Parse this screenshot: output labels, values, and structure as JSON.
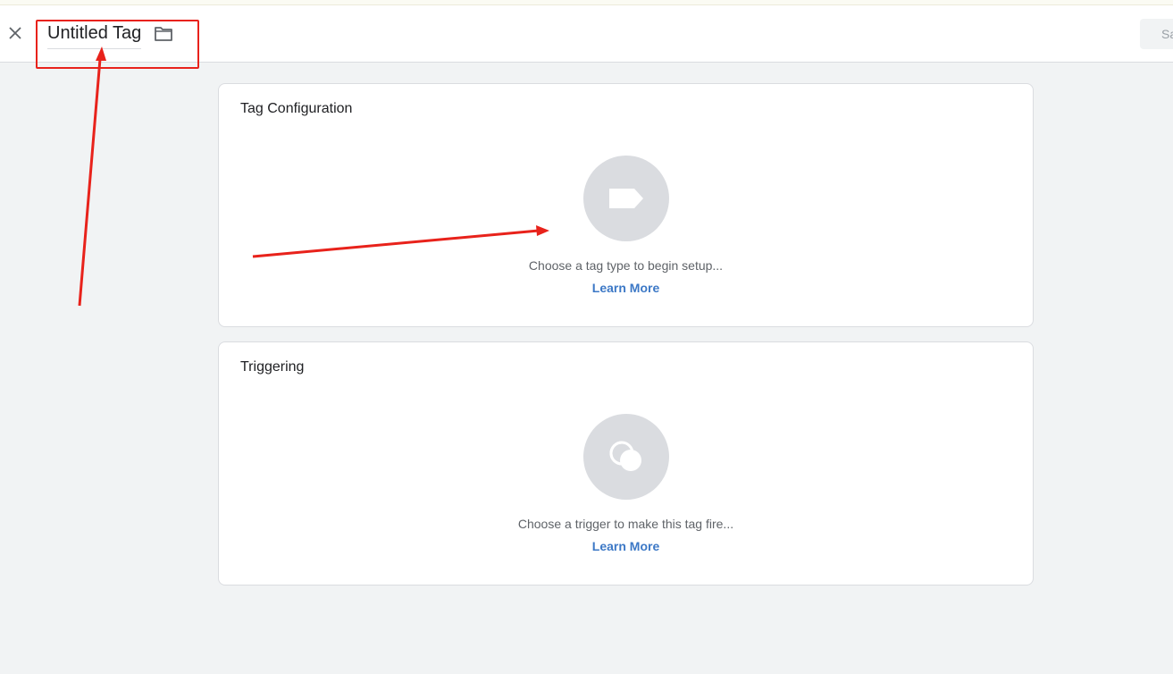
{
  "header": {
    "title": "Untitled Tag",
    "save_label": "Save"
  },
  "tag_card": {
    "title": "Tag Configuration",
    "hint": "Choose a tag type to begin setup...",
    "link": "Learn More"
  },
  "trigger_card": {
    "title": "Triggering",
    "hint": "Choose a trigger to make this tag fire...",
    "link": "Learn More"
  },
  "colors": {
    "accent_link": "#3c78c6",
    "annotation_red": "#e8221b",
    "placeholder_circle": "#dadce0"
  },
  "icons": [
    "close-icon",
    "folder-icon",
    "tag-icon",
    "trigger-icon"
  ]
}
